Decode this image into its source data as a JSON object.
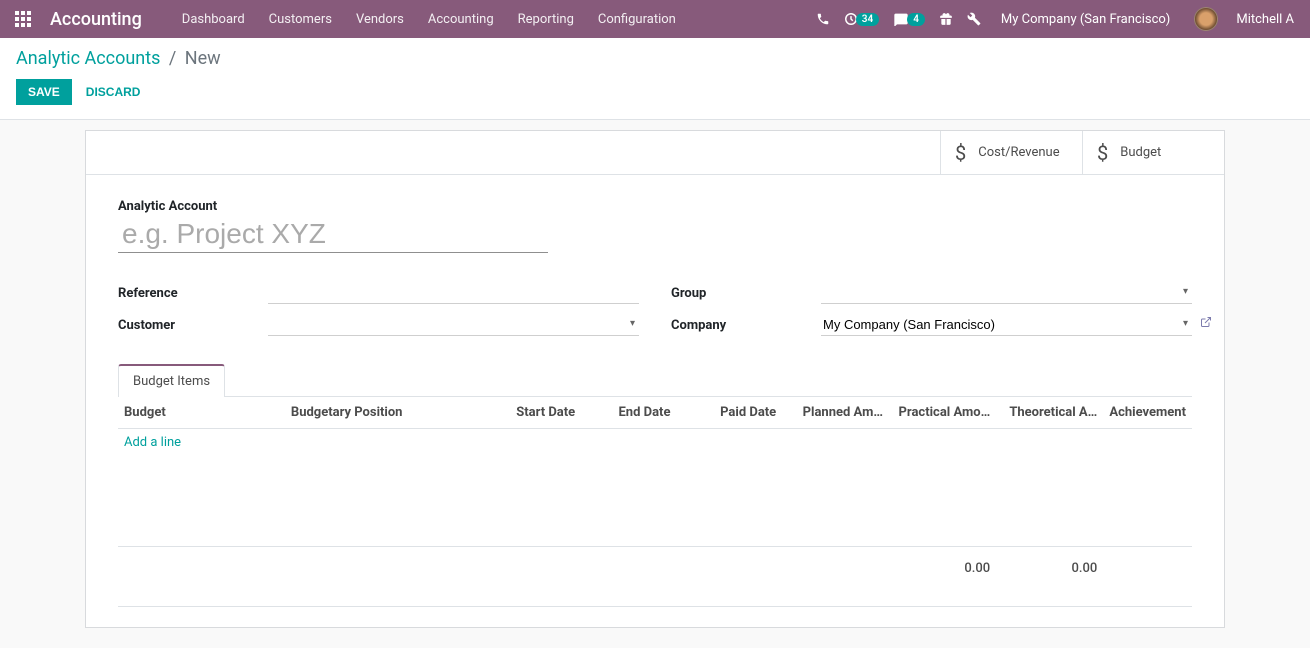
{
  "navbar": {
    "app_title": "Accounting",
    "menu": [
      "Dashboard",
      "Customers",
      "Vendors",
      "Accounting",
      "Reporting",
      "Configuration"
    ],
    "badge_activities": "34",
    "badge_messages": "4",
    "company": "My Company (San Francisco)",
    "user": "Mitchell A"
  },
  "breadcrumb": {
    "parent": "Analytic Accounts",
    "current": "New"
  },
  "buttons": {
    "save": "SAVE",
    "discard": "DISCARD"
  },
  "stat_buttons": {
    "cost_revenue": "Cost/Revenue",
    "budget": "Budget"
  },
  "form": {
    "title_label": "Analytic Account",
    "title_placeholder": "e.g. Project XYZ",
    "title_value": "",
    "reference_label": "Reference",
    "reference_value": "",
    "customer_label": "Customer",
    "customer_value": "",
    "group_label": "Group",
    "group_value": "",
    "company_label": "Company",
    "company_value": "My Company (San Francisco)"
  },
  "notebook": {
    "tab1": "Budget Items"
  },
  "table": {
    "headers": {
      "budget": "Budget",
      "budgetary_position": "Budgetary Position",
      "start_date": "Start Date",
      "end_date": "End Date",
      "paid_date": "Paid Date",
      "planned_amount": "Planned Am…",
      "practical_amount": "Practical Amo…",
      "theoretical_amount": "Theoretical A…",
      "achievement": "Achievement"
    },
    "add_line": "Add a line",
    "totals": {
      "practical": "0.00",
      "theoretical": "0.00"
    }
  }
}
